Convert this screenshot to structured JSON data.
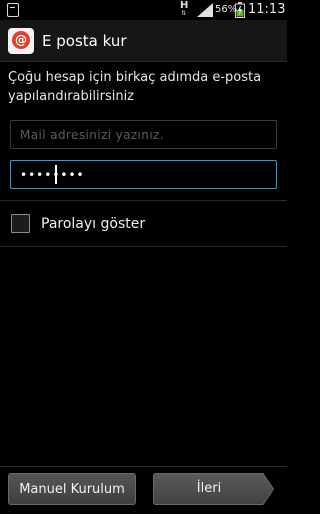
{
  "status_bar": {
    "network": "H",
    "battery": "56%",
    "time": "11:13",
    "icons": [
      "notification-icon",
      "hplus-icon",
      "signal-icon",
      "battery-icon"
    ]
  },
  "action_bar": {
    "title": "E posta kur",
    "icon": "email-app-icon",
    "icon_glyph": "@"
  },
  "form": {
    "intro": "Çoğu hesap için birkaç adımda e-posta yapılandırabilirsiniz",
    "email_placeholder": "Mail adresinizi yazınız.",
    "email_value": "",
    "password_value": "••••••••",
    "show_password_label": "Parolayı göster",
    "show_password_checked": false
  },
  "buttons": {
    "manual": "Manuel Kurulum",
    "next": "İleri"
  },
  "colors": {
    "accent": "#2f9ad8",
    "app_icon": "#e0412f"
  }
}
